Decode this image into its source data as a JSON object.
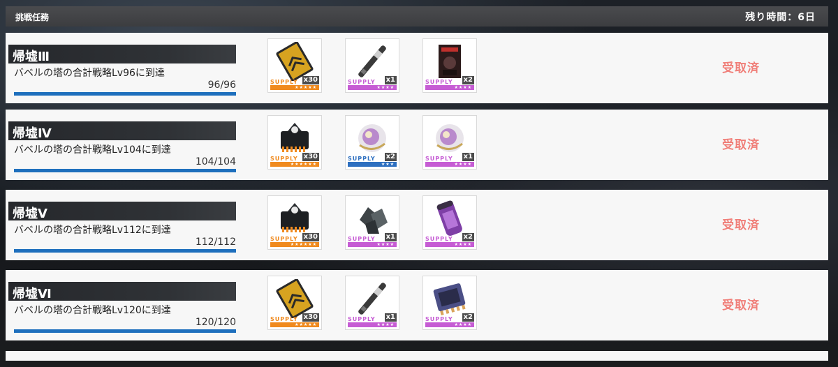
{
  "header": {
    "title": "挑戦任務",
    "remaining": "残り時間：6日"
  },
  "accent": {
    "received_color": "#f07e78",
    "progress_color": "#1e6fbd"
  },
  "missions": [
    {
      "name": "帰墟Ⅲ",
      "desc": "バベルの塔の合計戦略Lv96に到達",
      "progress": "96/96",
      "progress_fraction": 1.0,
      "status": "受取済",
      "rewards": [
        {
          "icon": "gold-card-icon",
          "supply": "SUPPLY",
          "qty": "x30",
          "rarity": "★★★★★",
          "color": "orange"
        },
        {
          "icon": "stick-icon",
          "supply": "SUPPLY",
          "qty": "x1",
          "rarity": "★★★★",
          "color": "purple"
        },
        {
          "icon": "poster-icon",
          "supply": "SUPPLY",
          "qty": "x2",
          "rarity": "★★★★",
          "color": "purple"
        }
      ]
    },
    {
      "name": "帰墟Ⅳ",
      "desc": "バベルの塔の合計戦略Lv104に到達",
      "progress": "104/104",
      "progress_fraction": 1.0,
      "status": "受取済",
      "rewards": [
        {
          "icon": "core-chip-icon",
          "supply": "SUPPLY",
          "qty": "x30",
          "rarity": "★★★★★★",
          "color": "orange"
        },
        {
          "icon": "orb-icon",
          "supply": "SUPPLY",
          "qty": "x2",
          "rarity": "★★★",
          "color": "blue"
        },
        {
          "icon": "orb-icon",
          "supply": "SUPPLY",
          "qty": "x1",
          "rarity": "★★★★",
          "color": "purple"
        }
      ]
    },
    {
      "name": "帰墟Ⅴ",
      "desc": "バベルの塔の合計戦略Lv112に到達",
      "progress": "112/112",
      "progress_fraction": 1.0,
      "status": "受取済",
      "rewards": [
        {
          "icon": "core-chip-icon",
          "supply": "SUPPLY",
          "qty": "x30",
          "rarity": "★★★★★★",
          "color": "orange"
        },
        {
          "icon": "crystal-icon",
          "supply": "SUPPLY",
          "qty": "x1",
          "rarity": "★★★★",
          "color": "purple"
        },
        {
          "icon": "canister-icon",
          "supply": "SUPPLY",
          "qty": "x2",
          "rarity": "★★★★",
          "color": "purple"
        }
      ]
    },
    {
      "name": "帰墟Ⅵ",
      "desc": "バベルの塔の合計戦略Lv120に到達",
      "progress": "120/120",
      "progress_fraction": 1.0,
      "status": "受取済",
      "rewards": [
        {
          "icon": "gold-card-icon",
          "supply": "SUPPLY",
          "qty": "x30",
          "rarity": "★★★★★",
          "color": "orange"
        },
        {
          "icon": "stick-icon",
          "supply": "SUPPLY",
          "qty": "x1",
          "rarity": "★★★★",
          "color": "purple"
        },
        {
          "icon": "cpu-chip-icon",
          "supply": "SUPPLY",
          "qty": "x2",
          "rarity": "★★★★",
          "color": "purple"
        }
      ]
    }
  ]
}
